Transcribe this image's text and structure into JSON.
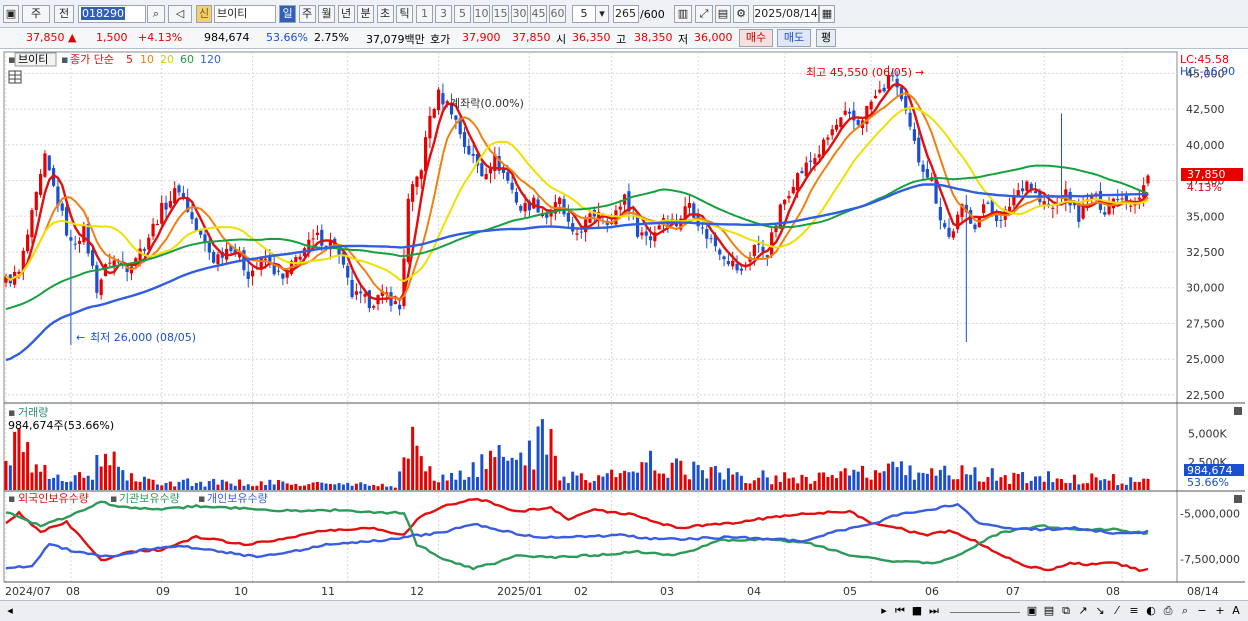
{
  "toolbar": {
    "period": "주",
    "prev": "전",
    "code": "018290",
    "type_badge": "신",
    "stock_name": "브이티",
    "periods": [
      "일",
      "주",
      "월",
      "년",
      "분",
      "초",
      "틱"
    ],
    "nums": [
      "1",
      "3",
      "5",
      "10",
      "15",
      "30",
      "45",
      "60"
    ],
    "interval": "5",
    "count": "265",
    "count_max": "/600",
    "date": "2025/08/14"
  },
  "quote": {
    "price": "37,850",
    "arrow": "▲",
    "change": "1,500",
    "change_pct": "+4.13%",
    "volume": "984,674",
    "vol_ratio": "53.66%",
    "turnover": "2.75%",
    "amount": "37,079백만",
    "hoga_label": "호가",
    "hoga1": "37,900",
    "hoga2": "37,850",
    "open_label": "시",
    "open": "36,350",
    "high_label": "고",
    "high": "38,350",
    "low_label": "저",
    "low": "36,000",
    "buy": "매수",
    "sell": "매도",
    "avg": "평"
  },
  "price_panel": {
    "name": "브이티",
    "legend_title": "종가 단순",
    "ma_labels": [
      "5",
      "10",
      "20",
      "60",
      "120"
    ],
    "lc": "LC:45.58",
    "hc": "HC:-16.90",
    "high_annot": "최고 45,550 (06/05)",
    "low_annot": "최저 26,000 (08/05)",
    "misc_annot": "계좌락(0.00%)",
    "y_ticks": [
      "45,000",
      "42,500",
      "40,000",
      "37,500",
      "35,000",
      "32,500",
      "30,000",
      "27,500",
      "25,000",
      "22,500"
    ],
    "last_price": "37,850",
    "last_pct": "4.13%"
  },
  "volume_panel": {
    "title": "거래량",
    "info": "984,674주(53.66%)",
    "y_ticks": [
      "5,000K",
      "2,500K",
      "0K"
    ],
    "last_vol": "984,674",
    "last_pct": "53.66%"
  },
  "holding_panel": {
    "series_names": [
      "외국인보유수량",
      "기관보유수량",
      "개인보유수량"
    ],
    "y_ticks": [
      "-5,000,000",
      "-7,500,000"
    ]
  },
  "x_ticks": [
    "2024/07",
    "08",
    "09",
    "10",
    "11",
    "12",
    "2025/01",
    "02",
    "03",
    "04",
    "05",
    "06",
    "07",
    "08",
    "08/14"
  ],
  "colors": {
    "up": "#e60000",
    "down": "#1a4fd0",
    "ma5": "#e01010",
    "ma10": "#f08010",
    "ma20": "#f0e000",
    "ma60": "#18a040",
    "ma120": "#2f5fe0",
    "inst": "#2e9a5a",
    "indiv": "#3a5ce0"
  },
  "chart_data": {
    "type": "candlestick",
    "x_range": [
      "2024/07",
      "2025/08/14"
    ],
    "y_range": [
      22000,
      46500
    ],
    "high": {
      "value": 45550,
      "date": "06/05"
    },
    "low": {
      "value": 26000,
      "date": "08/05"
    },
    "last": 37850,
    "price_keypoints": [
      [
        0,
        30500
      ],
      [
        3,
        31000
      ],
      [
        6,
        35000
      ],
      [
        9,
        39000
      ],
      [
        12,
        36000
      ],
      [
        15,
        33000
      ],
      [
        18,
        34000
      ],
      [
        21,
        30000
      ],
      [
        24,
        32000
      ],
      [
        28,
        31500
      ],
      [
        32,
        33000
      ],
      [
        36,
        35500
      ],
      [
        40,
        37000
      ],
      [
        44,
        34000
      ],
      [
        48,
        32000
      ],
      [
        52,
        33000
      ],
      [
        56,
        31000
      ],
      [
        60,
        32000
      ],
      [
        64,
        30500
      ],
      [
        68,
        32500
      ],
      [
        72,
        33500
      ],
      [
        76,
        33000
      ],
      [
        80,
        29500
      ],
      [
        84,
        29000
      ],
      [
        88,
        29500
      ],
      [
        91,
        28500
      ],
      [
        93,
        36000
      ],
      [
        96,
        38500
      ],
      [
        98,
        42000
      ],
      [
        100,
        43500
      ],
      [
        103,
        42500
      ],
      [
        106,
        40000
      ],
      [
        110,
        38000
      ],
      [
        113,
        39000
      ],
      [
        116,
        37500
      ],
      [
        119,
        35500
      ],
      [
        122,
        36000
      ],
      [
        125,
        35000
      ],
      [
        128,
        36000
      ],
      [
        131,
        33500
      ],
      [
        134,
        34500
      ],
      [
        137,
        35500
      ],
      [
        140,
        34500
      ],
      [
        143,
        36500
      ],
      [
        146,
        34000
      ],
      [
        149,
        33500
      ],
      [
        152,
        35000
      ],
      [
        155,
        34500
      ],
      [
        158,
        36000
      ],
      [
        161,
        34000
      ],
      [
        164,
        33000
      ],
      [
        167,
        32000
      ],
      [
        170,
        31000
      ],
      [
        173,
        33000
      ],
      [
        176,
        32500
      ],
      [
        179,
        35500
      ],
      [
        182,
        37500
      ],
      [
        185,
        38500
      ],
      [
        188,
        39500
      ],
      [
        191,
        41000
      ],
      [
        194,
        42000
      ],
      [
        197,
        41500
      ],
      [
        200,
        43000
      ],
      [
        203,
        44000
      ],
      [
        205,
        45000
      ],
      [
        207,
        43000
      ],
      [
        209,
        41000
      ],
      [
        211,
        39000
      ],
      [
        214,
        37500
      ],
      [
        216,
        35000
      ],
      [
        218,
        33500
      ],
      [
        221,
        35500
      ],
      [
        224,
        34500
      ],
      [
        227,
        36000
      ],
      [
        230,
        34500
      ],
      [
        233,
        36500
      ],
      [
        236,
        37500
      ],
      [
        239,
        36000
      ],
      [
        242,
        35500
      ],
      [
        245,
        36500
      ],
      [
        248,
        35000
      ],
      [
        251,
        36500
      ],
      [
        254,
        35500
      ],
      [
        257,
        36500
      ],
      [
        260,
        36000
      ],
      [
        262,
        36500
      ],
      [
        264,
        37850
      ]
    ],
    "vol_keypoints": [
      [
        0,
        2200
      ],
      [
        3,
        5500
      ],
      [
        5,
        3800
      ],
      [
        10,
        1500
      ],
      [
        20,
        1200
      ],
      [
        21,
        4200
      ],
      [
        30,
        1000
      ],
      [
        50,
        800
      ],
      [
        70,
        700
      ],
      [
        90,
        500
      ],
      [
        92,
        2500
      ],
      [
        94,
        5600
      ],
      [
        96,
        3000
      ],
      [
        98,
        2000
      ],
      [
        100,
        1000
      ],
      [
        126,
        5400
      ],
      [
        128,
        1500
      ],
      [
        145,
        1700
      ],
      [
        147,
        3200
      ],
      [
        170,
        1400
      ],
      [
        190,
        1500
      ],
      [
        210,
        2200
      ],
      [
        230,
        1500
      ],
      [
        245,
        1300
      ],
      [
        255,
        1200
      ],
      [
        264,
        985
      ]
    ],
    "foreign": [
      [
        0,
        -5600
      ],
      [
        3,
        -5000
      ],
      [
        8,
        -6000
      ],
      [
        14,
        -5500
      ],
      [
        18,
        -6500
      ],
      [
        22,
        -7600
      ],
      [
        28,
        -7100
      ],
      [
        36,
        -7000
      ],
      [
        44,
        -6300
      ],
      [
        55,
        -6700
      ],
      [
        62,
        -6500
      ],
      [
        72,
        -6000
      ],
      [
        85,
        -5800
      ],
      [
        92,
        -6200
      ],
      [
        95,
        -5300
      ],
      [
        100,
        -4700
      ],
      [
        108,
        -4200
      ],
      [
        112,
        -4400
      ],
      [
        118,
        -4900
      ],
      [
        126,
        -4700
      ],
      [
        130,
        -5300
      ],
      [
        136,
        -4800
      ],
      [
        145,
        -5100
      ],
      [
        155,
        -5800
      ],
      [
        165,
        -5600
      ],
      [
        175,
        -5300
      ],
      [
        185,
        -5000
      ],
      [
        195,
        -4900
      ],
      [
        200,
        -5500
      ],
      [
        206,
        -5800
      ],
      [
        212,
        -6200
      ],
      [
        218,
        -6000
      ],
      [
        224,
        -6500
      ],
      [
        230,
        -7300
      ],
      [
        236,
        -7900
      ],
      [
        242,
        -8100
      ],
      [
        246,
        -7700
      ],
      [
        250,
        -7800
      ],
      [
        256,
        -7700
      ],
      [
        262,
        -8100
      ],
      [
        264,
        -8100
      ]
    ],
    "institution": [
      [
        0,
        -4900
      ],
      [
        8,
        -5700
      ],
      [
        14,
        -5200
      ],
      [
        22,
        -4400
      ],
      [
        28,
        -4700
      ],
      [
        36,
        -4800
      ],
      [
        44,
        -4600
      ],
      [
        52,
        -4700
      ],
      [
        62,
        -4900
      ],
      [
        72,
        -4800
      ],
      [
        82,
        -4900
      ],
      [
        92,
        -5000
      ],
      [
        95,
        -6700
      ],
      [
        102,
        -7600
      ],
      [
        108,
        -8000
      ],
      [
        112,
        -7800
      ],
      [
        118,
        -7300
      ],
      [
        126,
        -7400
      ],
      [
        136,
        -7300
      ],
      [
        145,
        -7100
      ],
      [
        155,
        -7300
      ],
      [
        165,
        -6500
      ],
      [
        175,
        -6400
      ],
      [
        185,
        -6600
      ],
      [
        195,
        -7300
      ],
      [
        205,
        -7600
      ],
      [
        215,
        -7700
      ],
      [
        222,
        -7100
      ],
      [
        228,
        -6200
      ],
      [
        234,
        -5900
      ],
      [
        240,
        -5700
      ],
      [
        248,
        -5900
      ],
      [
        256,
        -5900
      ],
      [
        264,
        -6100
      ]
    ],
    "individual": [
      [
        0,
        -8000
      ],
      [
        6,
        -7900
      ],
      [
        10,
        -6700
      ],
      [
        16,
        -7100
      ],
      [
        24,
        -7400
      ],
      [
        32,
        -7000
      ],
      [
        40,
        -6800
      ],
      [
        50,
        -7100
      ],
      [
        58,
        -7400
      ],
      [
        66,
        -7100
      ],
      [
        74,
        -6700
      ],
      [
        80,
        -6600
      ],
      [
        86,
        -6500
      ],
      [
        92,
        -6300
      ],
      [
        100,
        -6100
      ],
      [
        108,
        -5600
      ],
      [
        114,
        -5900
      ],
      [
        122,
        -6300
      ],
      [
        132,
        -6300
      ],
      [
        142,
        -6200
      ],
      [
        150,
        -6400
      ],
      [
        158,
        -6400
      ],
      [
        168,
        -6300
      ],
      [
        176,
        -6400
      ],
      [
        184,
        -6500
      ],
      [
        192,
        -6000
      ],
      [
        200,
        -5600
      ],
      [
        206,
        -5100
      ],
      [
        214,
        -4800
      ],
      [
        220,
        -4500
      ],
      [
        225,
        -5600
      ],
      [
        232,
        -5800
      ],
      [
        240,
        -5900
      ],
      [
        248,
        -5800
      ],
      [
        256,
        -6100
      ],
      [
        264,
        -6000
      ]
    ]
  }
}
